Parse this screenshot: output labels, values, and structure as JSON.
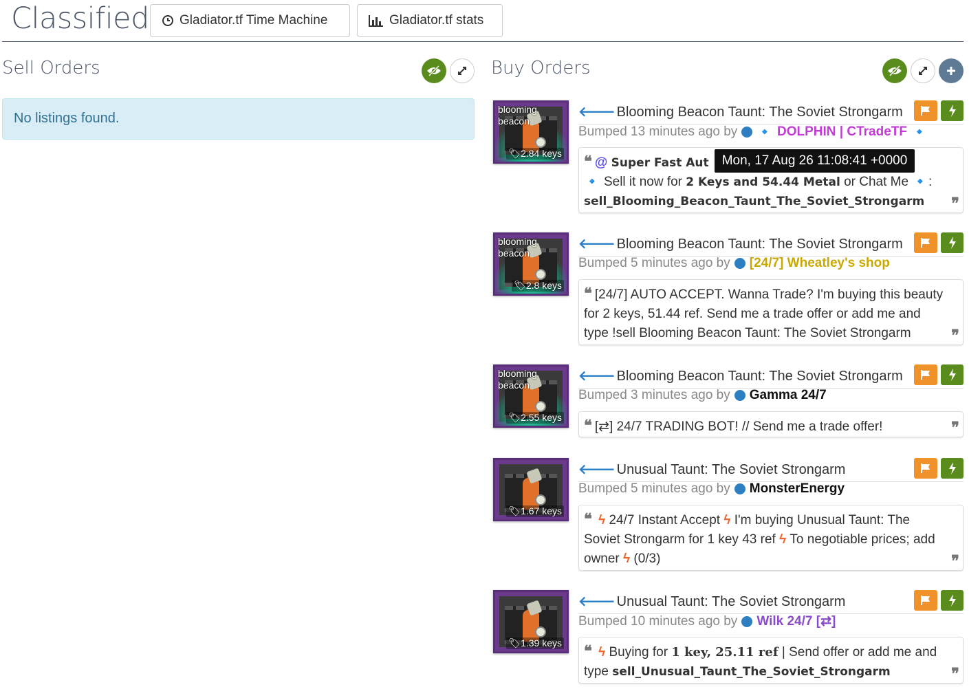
{
  "header": {
    "title": "Classifieds",
    "time_machine_label": "Gladiator.tf Time Machine",
    "stats_label": "Gladiator.tf stats"
  },
  "sell": {
    "title": "Sell Orders",
    "empty_message": "No listings found."
  },
  "buy": {
    "title": "Buy Orders",
    "listings": [
      {
        "effect": "blooming beacon",
        "price": "2.84 keys",
        "item": "Blooming Beacon Taunt: The Soviet Strongarm",
        "bumped": "Bumped 13 minutes ago by",
        "user": "DOLPHIN | CTradeTF",
        "user_color": "#c23bd4",
        "msg_a": "Super Fast Aut",
        "msg_b": "Sell it now for",
        "msg_c": "2 Keys and 54.44 Metal",
        "msg_d": "or Chat Me",
        "msg_e": "sell_Blooming_Beacon_Taunt_The_Soviet_Strongarm"
      },
      {
        "effect": "blooming beacon",
        "price": "2.8 keys",
        "item": "Blooming Beacon Taunt: The Soviet Strongarm",
        "bumped": "Bumped 5 minutes ago by",
        "user": "[24/7] Wheatley's shop",
        "user_color": "#c9a800",
        "msg": "[24/7] AUTO ACCEPT. Wanna Trade? I'm buying this beauty for 2 keys, 51.44 ref. Send me a trade offer or add me and type !sell Blooming Beacon Taunt: The Soviet Strongarm"
      },
      {
        "effect": "blooming beacon",
        "price": "2.55 keys",
        "item": "Blooming Beacon Taunt: The Soviet Strongarm",
        "bumped": "Bumped 3 minutes ago by",
        "user": "Gamma 24/7",
        "user_color": "#111111",
        "msg": "[⇄] 24/7 TRADING BOT! // Send me a trade offer!"
      },
      {
        "price": "1.67 keys",
        "item": "Unusual Taunt: The Soviet Strongarm",
        "bumped": "Bumped 5 minutes ago by",
        "user": "MonsterEnergy",
        "user_color": "#111111",
        "msg_a": "24/7 Instant Accept",
        "msg_b": "I'm buying Unusual Taunt: The Soviet Strongarm for 1 key 43 ref",
        "msg_c": "To negotiable prices; add owner",
        "msg_d": "(0/3)"
      },
      {
        "price": "1.39 keys",
        "item": "Unusual Taunt: The Soviet Strongarm",
        "bumped": "Bumped 10 minutes ago by",
        "user": "Wilk 24/7 [⇄]",
        "user_color": "#8a4bc9",
        "msg_a": "Buying for",
        "msg_b": "1 key, 25.11 ref",
        "msg_c": "| Send offer or add me and type",
        "msg_d": "sell_Unusual_Taunt_The_Soviet_Strongarm"
      }
    ]
  },
  "tooltip": "Mon, 17 Aug 26 11:08:41 +0000",
  "colors": {
    "accent_green": "#5a8c1d",
    "flag_orange": "#f0922b",
    "arrow_blue": "#2a7fc9"
  }
}
